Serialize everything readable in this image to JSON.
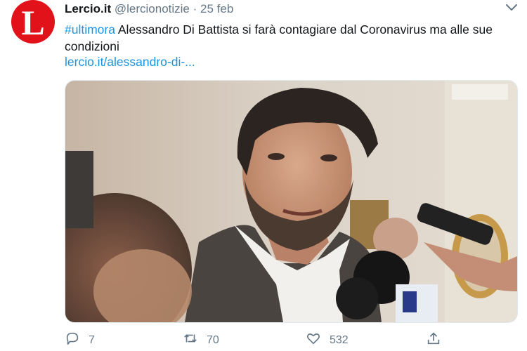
{
  "tweet": {
    "author_name": "Lercio.it",
    "author_handle": "@lercionotizie",
    "separator": "·",
    "date": "25 feb",
    "hashtag": "#ultimora",
    "text": " Alessandro Di Battista si farà contagiare dal Coronavirus ma alle sue condizioni",
    "link": "lercio.it/alessandro-di-..."
  },
  "avatar": {
    "logo_letter": "L",
    "color": "#e2121b"
  },
  "actions": {
    "reply_count": "7",
    "retweet_count": "70",
    "like_count": "532"
  },
  "icons": {
    "reply": "reply-icon",
    "retweet": "retweet-icon",
    "like": "heart-icon",
    "share": "share-icon",
    "menu": "chevron-down-icon"
  },
  "colors": {
    "link": "#1b95e0",
    "muted": "#657786",
    "text": "#14171a"
  }
}
